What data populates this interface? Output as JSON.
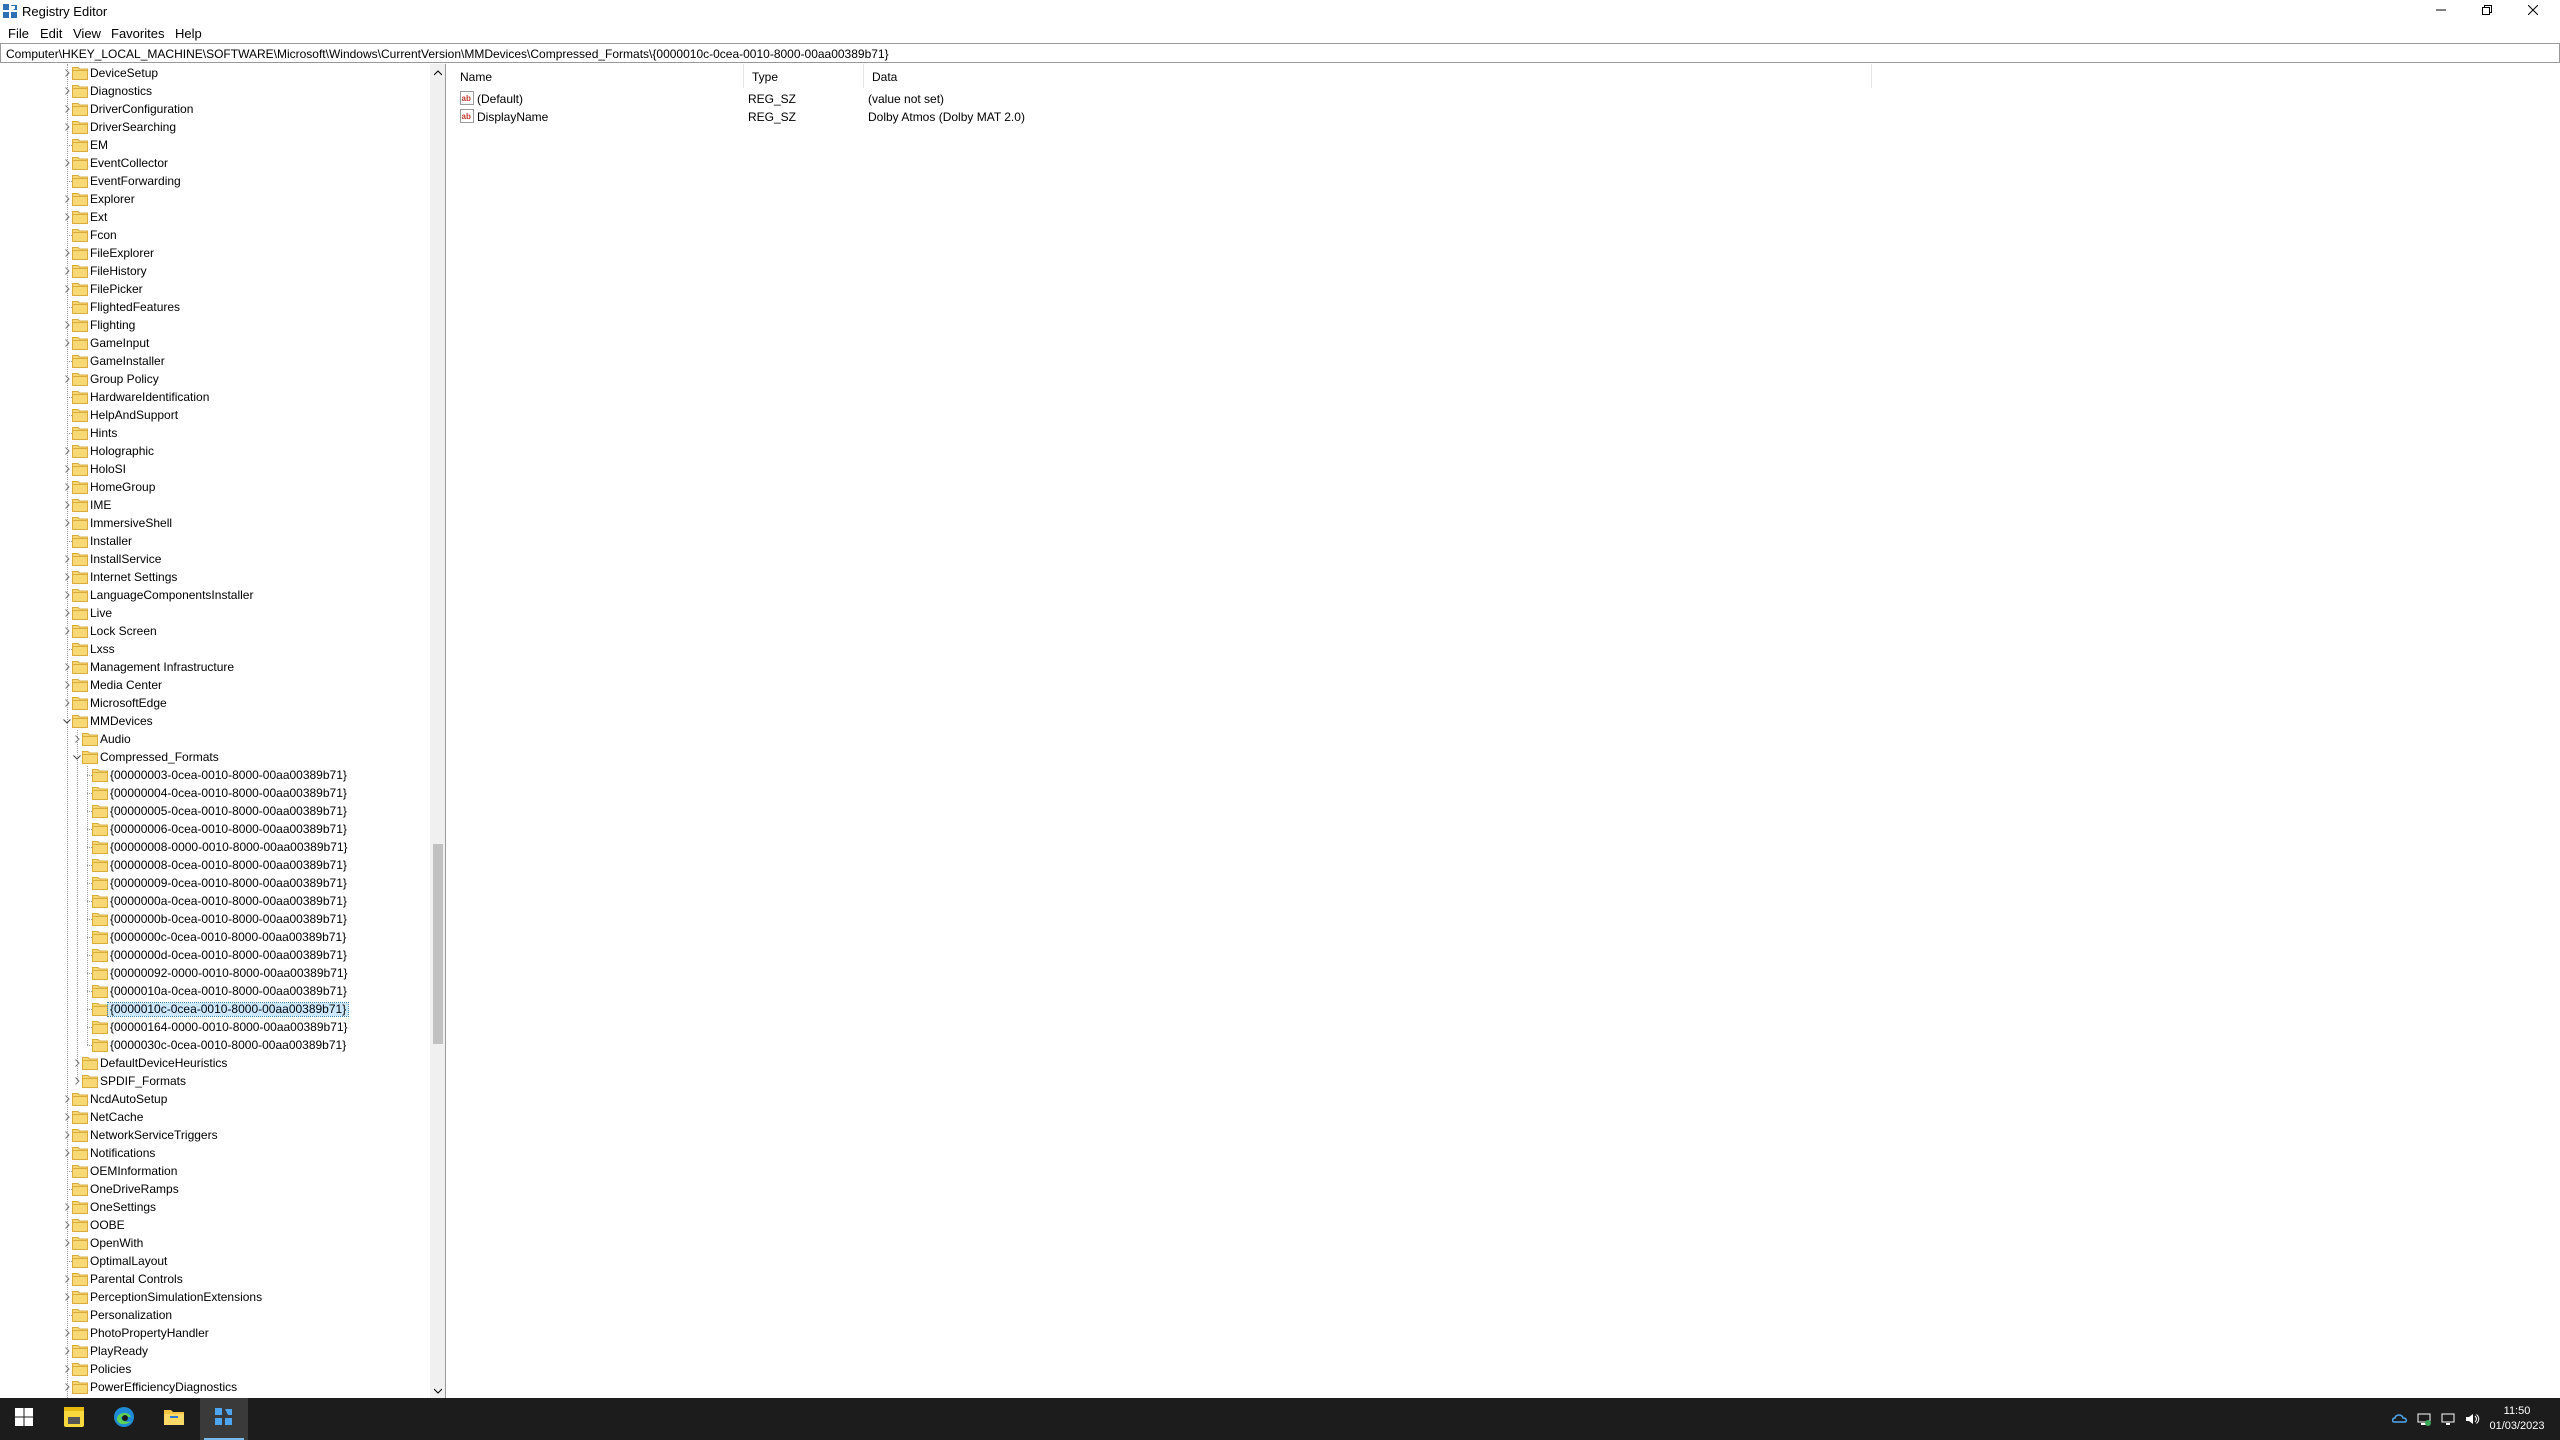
{
  "window": {
    "title": "Registry Editor",
    "controls": {
      "minimize": "minimize-icon",
      "restore": "restore-icon",
      "close": "close-icon"
    }
  },
  "menu": [
    "File",
    "Edit",
    "View",
    "Favorites",
    "Help"
  ],
  "address": "Computer\\HKEY_LOCAL_MACHINE\\SOFTWARE\\Microsoft\\Windows\\CurrentVersion\\MMDevices\\Compressed_Formats\\{0000010c-0cea-0010-8000-00aa00389b71}",
  "tree": [
    {
      "label": "DeviceSetup",
      "level": 0,
      "state": "collapsed"
    },
    {
      "label": "Diagnostics",
      "level": 0,
      "state": "collapsed"
    },
    {
      "label": "DriverConfiguration",
      "level": 0,
      "state": "collapsed"
    },
    {
      "label": "DriverSearching",
      "level": 0,
      "state": "collapsed"
    },
    {
      "label": "EM",
      "level": 0,
      "state": "leaf"
    },
    {
      "label": "EventCollector",
      "level": 0,
      "state": "collapsed"
    },
    {
      "label": "EventForwarding",
      "level": 0,
      "state": "leaf"
    },
    {
      "label": "Explorer",
      "level": 0,
      "state": "collapsed"
    },
    {
      "label": "Ext",
      "level": 0,
      "state": "collapsed"
    },
    {
      "label": "Fcon",
      "level": 0,
      "state": "leaf"
    },
    {
      "label": "FileExplorer",
      "level": 0,
      "state": "collapsed"
    },
    {
      "label": "FileHistory",
      "level": 0,
      "state": "collapsed"
    },
    {
      "label": "FilePicker",
      "level": 0,
      "state": "collapsed"
    },
    {
      "label": "FlightedFeatures",
      "level": 0,
      "state": "leaf"
    },
    {
      "label": "Flighting",
      "level": 0,
      "state": "collapsed"
    },
    {
      "label": "GameInput",
      "level": 0,
      "state": "collapsed"
    },
    {
      "label": "GameInstaller",
      "level": 0,
      "state": "leaf"
    },
    {
      "label": "Group Policy",
      "level": 0,
      "state": "collapsed"
    },
    {
      "label": "HardwareIdentification",
      "level": 0,
      "state": "leaf"
    },
    {
      "label": "HelpAndSupport",
      "level": 0,
      "state": "leaf"
    },
    {
      "label": "Hints",
      "level": 0,
      "state": "leaf"
    },
    {
      "label": "Holographic",
      "level": 0,
      "state": "collapsed"
    },
    {
      "label": "HoloSI",
      "level": 0,
      "state": "collapsed"
    },
    {
      "label": "HomeGroup",
      "level": 0,
      "state": "collapsed"
    },
    {
      "label": "IME",
      "level": 0,
      "state": "collapsed"
    },
    {
      "label": "ImmersiveShell",
      "level": 0,
      "state": "collapsed"
    },
    {
      "label": "Installer",
      "level": 0,
      "state": "leaf"
    },
    {
      "label": "InstallService",
      "level": 0,
      "state": "collapsed"
    },
    {
      "label": "Internet Settings",
      "level": 0,
      "state": "collapsed"
    },
    {
      "label": "LanguageComponentsInstaller",
      "level": 0,
      "state": "collapsed"
    },
    {
      "label": "Live",
      "level": 0,
      "state": "collapsed"
    },
    {
      "label": "Lock Screen",
      "level": 0,
      "state": "collapsed"
    },
    {
      "label": "Lxss",
      "level": 0,
      "state": "leaf"
    },
    {
      "label": "Management Infrastructure",
      "level": 0,
      "state": "collapsed"
    },
    {
      "label": "Media Center",
      "level": 0,
      "state": "collapsed"
    },
    {
      "label": "MicrosoftEdge",
      "level": 0,
      "state": "collapsed"
    },
    {
      "label": "MMDevices",
      "level": 0,
      "state": "expanded"
    },
    {
      "label": "Audio",
      "level": 1,
      "state": "collapsed"
    },
    {
      "label": "Compressed_Formats",
      "level": 1,
      "state": "expanded"
    },
    {
      "label": "{00000003-0cea-0010-8000-00aa00389b71}",
      "level": 2,
      "state": "leaf"
    },
    {
      "label": "{00000004-0cea-0010-8000-00aa00389b71}",
      "level": 2,
      "state": "leaf"
    },
    {
      "label": "{00000005-0cea-0010-8000-00aa00389b71}",
      "level": 2,
      "state": "leaf"
    },
    {
      "label": "{00000006-0cea-0010-8000-00aa00389b71}",
      "level": 2,
      "state": "leaf"
    },
    {
      "label": "{00000008-0000-0010-8000-00aa00389b71}",
      "level": 2,
      "state": "leaf"
    },
    {
      "label": "{00000008-0cea-0010-8000-00aa00389b71}",
      "level": 2,
      "state": "leaf"
    },
    {
      "label": "{00000009-0cea-0010-8000-00aa00389b71}",
      "level": 2,
      "state": "leaf"
    },
    {
      "label": "{0000000a-0cea-0010-8000-00aa00389b71}",
      "level": 2,
      "state": "leaf"
    },
    {
      "label": "{0000000b-0cea-0010-8000-00aa00389b71}",
      "level": 2,
      "state": "leaf"
    },
    {
      "label": "{0000000c-0cea-0010-8000-00aa00389b71}",
      "level": 2,
      "state": "leaf"
    },
    {
      "label": "{0000000d-0cea-0010-8000-00aa00389b71}",
      "level": 2,
      "state": "leaf"
    },
    {
      "label": "{00000092-0000-0010-8000-00aa00389b71}",
      "level": 2,
      "state": "leaf"
    },
    {
      "label": "{0000010a-0cea-0010-8000-00aa00389b71}",
      "level": 2,
      "state": "leaf"
    },
    {
      "label": "{0000010c-0cea-0010-8000-00aa00389b71}",
      "level": 2,
      "state": "leaf",
      "selected": true
    },
    {
      "label": "{00000164-0000-0010-8000-00aa00389b71}",
      "level": 2,
      "state": "leaf"
    },
    {
      "label": "{0000030c-0cea-0010-8000-00aa00389b71}",
      "level": 2,
      "state": "leaf"
    },
    {
      "label": "DefaultDeviceHeuristics",
      "level": 1,
      "state": "collapsed"
    },
    {
      "label": "SPDIF_Formats",
      "level": 1,
      "state": "collapsed"
    },
    {
      "label": "NcdAutoSetup",
      "level": 0,
      "state": "collapsed"
    },
    {
      "label": "NetCache",
      "level": 0,
      "state": "collapsed"
    },
    {
      "label": "NetworkServiceTriggers",
      "level": 0,
      "state": "collapsed"
    },
    {
      "label": "Notifications",
      "level": 0,
      "state": "collapsed"
    },
    {
      "label": "OEMInformation",
      "level": 0,
      "state": "leaf"
    },
    {
      "label": "OneDriveRamps",
      "level": 0,
      "state": "leaf"
    },
    {
      "label": "OneSettings",
      "level": 0,
      "state": "collapsed"
    },
    {
      "label": "OOBE",
      "level": 0,
      "state": "collapsed"
    },
    {
      "label": "OpenWith",
      "level": 0,
      "state": "collapsed"
    },
    {
      "label": "OptimalLayout",
      "level": 0,
      "state": "leaf"
    },
    {
      "label": "Parental Controls",
      "level": 0,
      "state": "collapsed"
    },
    {
      "label": "PerceptionSimulationExtensions",
      "level": 0,
      "state": "collapsed"
    },
    {
      "label": "Personalization",
      "level": 0,
      "state": "leaf"
    },
    {
      "label": "PhotoPropertyHandler",
      "level": 0,
      "state": "collapsed"
    },
    {
      "label": "PlayReady",
      "level": 0,
      "state": "collapsed"
    },
    {
      "label": "Policies",
      "level": 0,
      "state": "collapsed"
    },
    {
      "label": "PowerEfficiencyDiagnostics",
      "level": 0,
      "state": "collapsed"
    }
  ],
  "values": {
    "columns": {
      "name": "Name",
      "type": "Type",
      "data": "Data"
    },
    "rows": [
      {
        "name": "(Default)",
        "type": "REG_SZ",
        "data": "(value not set)",
        "icon": "string-value-icon"
      },
      {
        "name": "DisplayName",
        "type": "REG_SZ",
        "data": "Dolby Atmos (Dolby MAT 2.0)",
        "icon": "string-value-icon"
      }
    ]
  },
  "taskbar": {
    "apps": [
      {
        "name": "start-button",
        "icon": "windows-logo-icon",
        "active": false
      },
      {
        "name": "sticky-notes-button",
        "icon": "sticky-notes-icon",
        "active": false
      },
      {
        "name": "edge-button",
        "icon": "edge-icon",
        "active": false
      },
      {
        "name": "file-explorer-button",
        "icon": "folder-icon",
        "active": false
      },
      {
        "name": "registry-editor-button",
        "icon": "regedit-icon",
        "active": true
      }
    ],
    "tray": [
      "onedrive-icon",
      "network-sync-icon",
      "network-icon",
      "volume-icon"
    ],
    "time": "11:50",
    "date": "01/03/2023"
  },
  "colors": {
    "selection": "#cce8ff",
    "taskbar": "#1c1c1c",
    "folder": "#f8d775"
  }
}
